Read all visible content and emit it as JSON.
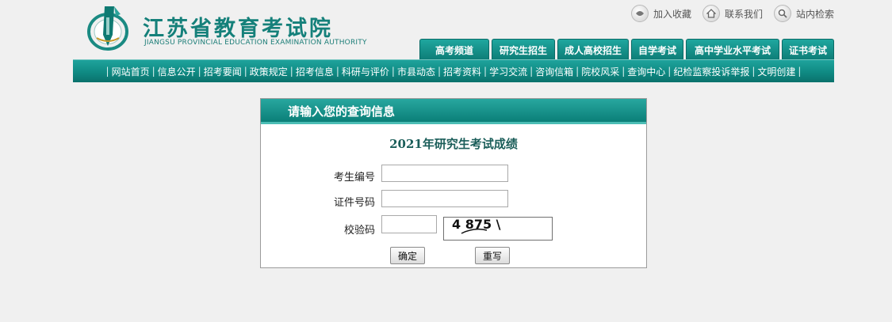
{
  "site": {
    "name_cn": "江苏省教育考试院",
    "name_en": "JIANGSU PROVINCIAL EDUCATION EXAMINATION AUTHORITY",
    "colors": {
      "brand": "#0f8a83",
      "accent": "#1fa79f",
      "background": "#f0f0f0"
    }
  },
  "toplinks": [
    {
      "label": "加入收藏",
      "icon": "bookmark-icon"
    },
    {
      "label": "联系我们",
      "icon": "home-icon"
    },
    {
      "label": "站内检索",
      "icon": "search-icon"
    }
  ],
  "tabs": [
    "高考频道",
    "研究生招生",
    "成人高校招生",
    "自学考试",
    "高中学业水平考试",
    "证书考试"
  ],
  "nav": [
    "网站首页",
    "信息公开",
    "招考要闻",
    "政策规定",
    "招考信息",
    "科研与评价",
    "市县动态",
    "招考资料",
    "学习交流",
    "咨询信箱",
    "院校风采",
    "查询中心",
    "纪检监察投诉举报",
    "文明创建"
  ],
  "panel": {
    "header": "请输入您的查询信息",
    "exam_title": "2021年研究生考试成绩",
    "fields": {
      "exam_number": {
        "label": "考生编号",
        "value": "",
        "placeholder": ""
      },
      "id_number": {
        "label": "证件号码",
        "value": "",
        "placeholder": ""
      },
      "verify_code": {
        "label": "校验码",
        "value": "",
        "placeholder": ""
      }
    },
    "captcha_text": "4 875 \\",
    "buttons": {
      "confirm": "确定",
      "reset": "重写"
    }
  }
}
